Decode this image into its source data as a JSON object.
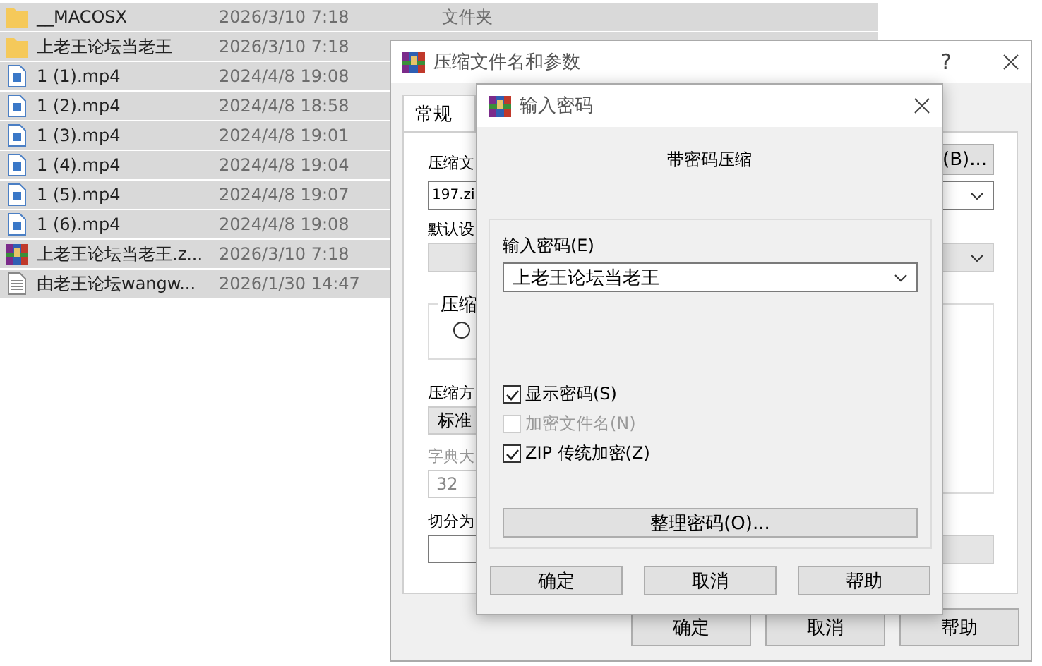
{
  "file_list": {
    "rows": [
      {
        "kind": "folder",
        "name": "__MACOSX",
        "modified": "2026/3/10 7:18",
        "type": "文件夹",
        "selected": true
      },
      {
        "kind": "folder",
        "name": "上老王论坛当老王",
        "modified": "2026/3/10 7:18",
        "selected": true
      },
      {
        "kind": "video",
        "name": "1 (1).mp4",
        "modified": "2024/4/8 19:08",
        "selected": true
      },
      {
        "kind": "video",
        "name": "1 (2).mp4",
        "modified": "2024/4/8 18:58",
        "selected": true
      },
      {
        "kind": "video",
        "name": "1 (3).mp4",
        "modified": "2024/4/8 19:01",
        "selected": true
      },
      {
        "kind": "video",
        "name": "1 (4).mp4",
        "modified": "2024/4/8 19:04",
        "selected": true
      },
      {
        "kind": "video",
        "name": "1 (5).mp4",
        "modified": "2024/4/8 19:07",
        "selected": true
      },
      {
        "kind": "video",
        "name": "1 (6).mp4",
        "modified": "2024/4/8 19:08",
        "selected": true
      },
      {
        "kind": "archive",
        "name": "上老王论坛当老王.z...",
        "modified": "2026/3/10 7:18",
        "selected": true
      },
      {
        "kind": "text",
        "name": "由老王论坛wangw...",
        "modified": "2026/1/30 14:47",
        "selected": true
      }
    ]
  },
  "archive_dialog": {
    "title": "压缩文件名和参数",
    "help_glyph": "?",
    "tabs": [
      {
        "label": "常规",
        "selected": true
      }
    ],
    "archive_name_label": "压缩文",
    "browse_button": "(B)...",
    "archive_name": "197.zi",
    "profile_label": "默认设",
    "format_group_label": "压缩",
    "format_radio": {
      "selected": false
    },
    "method_label": "压缩方",
    "method_value": "标准",
    "dictionary_label": "字典大",
    "dictionary_disabled": true,
    "dictionary_value": "32",
    "split_label": "切分为",
    "buttons": [
      "确定",
      "取消",
      "帮助"
    ]
  },
  "password_dialog": {
    "title": "输入密码",
    "heading": "带密码压缩",
    "password_label": "输入密码(E)",
    "password_value": "上老王论坛当老王",
    "options": [
      {
        "label": "显示密码(S)",
        "checked": true,
        "disabled": false
      },
      {
        "label": "加密文件名(N)",
        "checked": false,
        "disabled": true
      },
      {
        "label": "ZIP 传统加密(Z)",
        "checked": true,
        "disabled": false
      }
    ],
    "organize_button": "整理密码(O)...",
    "buttons": [
      "确定",
      "取消",
      "帮助"
    ]
  }
}
